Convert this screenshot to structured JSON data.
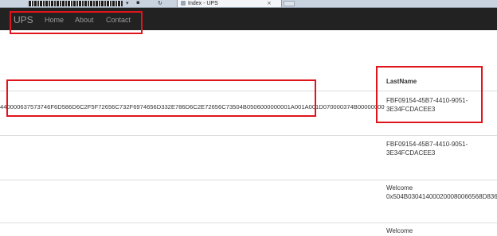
{
  "browser": {
    "tab_title": "Index - UPS",
    "tab_close": "×",
    "icons": [
      "dropdown-icon",
      "lock-icon",
      "refresh-icon"
    ]
  },
  "navbar": {
    "brand": "UPS",
    "links": [
      "Home",
      "About",
      "Contact"
    ]
  },
  "table": {
    "header_lastname": "LastName",
    "row1_value": "440000637573746F6D586D6C2F5F72656C732F6974656D332E786D6C2E72656C73504B0506000000001A001A001D070000374B00000000",
    "row1_lastname": [
      "FBF09154-45B7-4410-9051-",
      "3E34FCDACEE3"
    ],
    "row2_lastname": [
      "FBF09154-45B7-4410-9051-",
      "3E34FCDACEE3"
    ],
    "row3_lastname": [
      "Welcome",
      "0x504B030414000200080066568D836"
    ],
    "row4_lastname": [
      "Welcome"
    ]
  },
  "colors": {
    "navbar_bg": "#222222",
    "navbar_text": "#9d9d9d",
    "highlight": "#e0151c"
  }
}
